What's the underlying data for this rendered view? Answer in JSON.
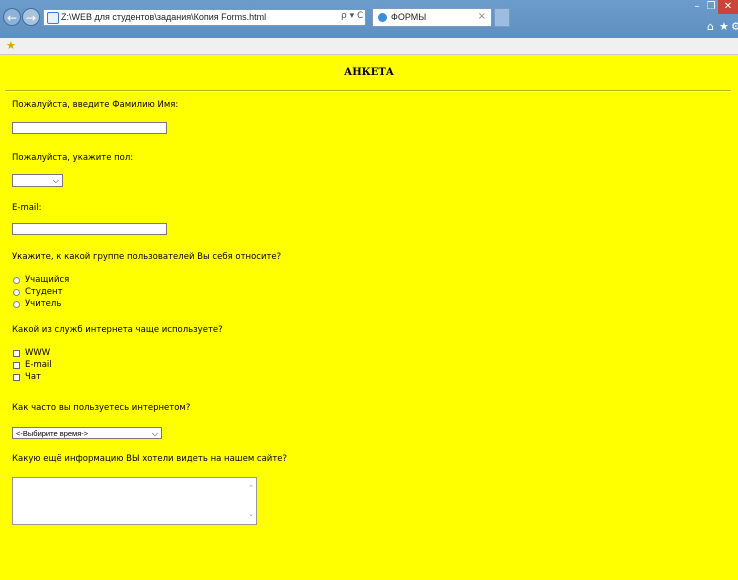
{
  "browser": {
    "address": "Z:\\WEB для студентов\\задания\\Копия Forms.html",
    "address_tools": "ρ ▾ C",
    "tab_title": "ФОРМЫ",
    "tab_close": "×",
    "win_min": "–",
    "win_max": "❐",
    "win_close": "✕",
    "icons": {
      "back": "back-arrow-icon",
      "forward": "forward-arrow-icon",
      "home": "home-icon",
      "star": "star-icon",
      "gear": "gear-icon"
    }
  },
  "form": {
    "heading": "АНКЕТА",
    "name_label": "Пожалуйста, введите Фамилию Имя:",
    "gender_label": "Пожалуйста, укажите пол:",
    "email_label": "E-mail:",
    "group_label": "Укажите, к какой группе пользователей Вы себя относите?",
    "groups": [
      "Учащийся",
      "Студент",
      "Учитель"
    ],
    "services_label": "Какой из служб интернета чаще используете?",
    "services": [
      "WWW",
      "E-mail",
      "Чат"
    ],
    "frequency_label": "Как часто вы пользуетесь интернетом?",
    "frequency_selected": "<-Выбирите время->",
    "info_label": "Какую ещё информацию ВЫ хотели видеть на нашем сайте?"
  }
}
